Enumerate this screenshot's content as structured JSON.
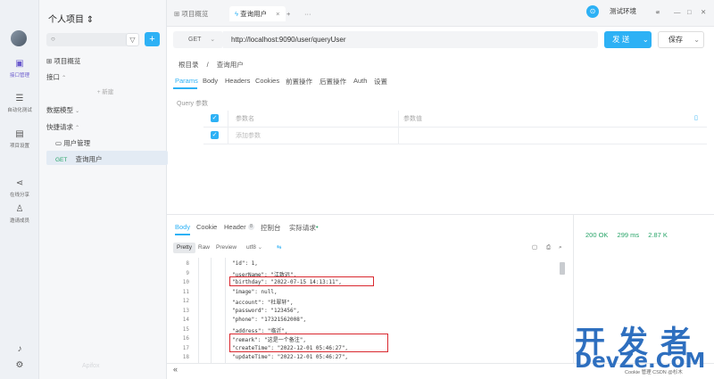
{
  "rail": {
    "items": [
      {
        "label": "接口管理",
        "icon": "api-icon"
      },
      {
        "label": "自动化测试",
        "icon": "automation-icon"
      },
      {
        "label": "项目设置",
        "icon": "settings-icon"
      },
      {
        "label": "在线分享",
        "icon": "share-icon"
      },
      {
        "label": "邀请成员",
        "icon": "invite-icon"
      }
    ]
  },
  "project": {
    "title": "个人项目 ⇕",
    "overview": "项目概览",
    "api_section": "接口",
    "new_label": "+ 新建",
    "data_models": "数据模型",
    "quick_requests": "快捷请求",
    "folder": "用户管理",
    "request_method": "GET",
    "request_name": "查询用户",
    "brand": "Apifox"
  },
  "tabs": {
    "overview": "项目概览",
    "active": "查询用户",
    "close": "×",
    "add": "+",
    "more": "···",
    "env": "测试环境"
  },
  "request": {
    "method": "GET",
    "url": "http://localhost:9090/user/queryUser",
    "send": "发 送",
    "save": "保存",
    "breadcrumb_root": "根目录",
    "breadcrumb_sep": "/",
    "breadcrumb_leaf": "查询用户",
    "tabs": [
      "Params",
      "Body",
      "Headers",
      "Cookies",
      "前置操作",
      "后置操作",
      "Auth",
      "设置"
    ],
    "query_label": "Query 参数",
    "param_name_header": "参数名",
    "param_value_header": "参数值",
    "param_placeholder": "添加参数"
  },
  "response": {
    "tabs": [
      "Body",
      "Cookie",
      "Header",
      "控制台",
      "实际请求"
    ],
    "header_count": "8",
    "formats": [
      "Pretty",
      "Raw",
      "Preview",
      "utf8"
    ],
    "status": "200 OK",
    "time": "299 ms",
    "size": "2.87 K",
    "lines": [
      {
        "n": "8",
        "text": "\"id\": 1,"
      },
      {
        "n": "9",
        "text": "\"userName\": \"江致远\","
      },
      {
        "n": "10",
        "text": "\"birthday\": \"2022-07-15 14:13:11\","
      },
      {
        "n": "11",
        "text": "\"image\": null,"
      },
      {
        "n": "12",
        "text": "\"account\": \"杜翠轩\","
      },
      {
        "n": "13",
        "text": "\"password\": \"123456\","
      },
      {
        "n": "14",
        "text": "\"phone\": \"17321562008\","
      },
      {
        "n": "15",
        "text": "\"address\": \"临沂\","
      },
      {
        "n": "16",
        "text": "\"remark\": \"这是一个备注\","
      },
      {
        "n": "17",
        "text": "\"createTime\": \"2022-12-01 05:46:27\","
      },
      {
        "n": "18",
        "text": "\"updateTime\": \"2022-12-01 05:46:27\","
      }
    ],
    "collapse": "«"
  },
  "watermark": {
    "top": "开发者",
    "bottom": "DevZe.CoM",
    "caption": "Cookie 管理   CSDN @杉木"
  },
  "colors": {
    "accent": "#2db1f5",
    "highlight": "#d9282f",
    "status": "#27a468",
    "watermark": "#2e6fbf"
  }
}
